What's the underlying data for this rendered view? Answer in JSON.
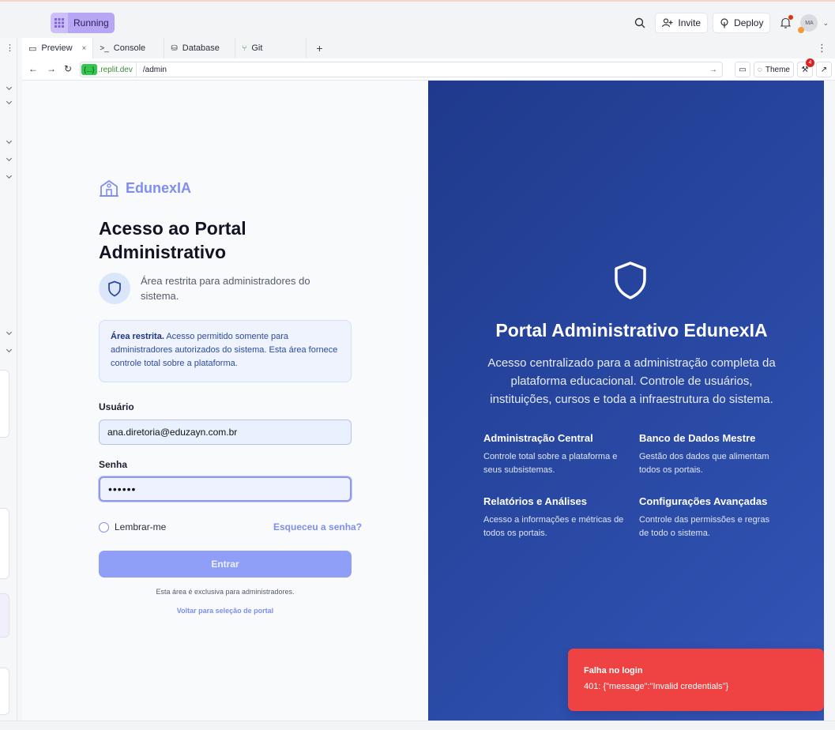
{
  "topbar": {
    "status_label": "Running",
    "invite_label": "Invite",
    "deploy_label": "Deploy",
    "avatar_initials": "MA"
  },
  "tabs": [
    {
      "label": "Preview",
      "active": true
    },
    {
      "label": "Console",
      "active": false
    },
    {
      "label": "Database",
      "active": false
    },
    {
      "label": "Git",
      "active": false
    }
  ],
  "urlbar": {
    "domain_chip": "{...}",
    "domain": ".replit.dev",
    "path": "/admin",
    "theme_label": "Theme",
    "notification_count": "4"
  },
  "login": {
    "brand": "EdunexIA",
    "title": "Acesso ao Portal Administrativo",
    "subtitle": "Área restrita para administradores do sistema.",
    "alert_bold": "Área restrita.",
    "alert_text": " Acesso permitido somente para administradores autorizados do sistema. Esta área fornece controle total sobre a plataforma.",
    "user_label": "Usuário",
    "user_value": "ana.diretoria@eduzayn.com.br",
    "password_label": "Senha",
    "password_value": "••••••",
    "remember_label": "Lembrar-me",
    "forgot_label": "Esqueceu a senha?",
    "submit_label": "Entrar",
    "exclusive_note": "Esta área é exclusiva para administradores.",
    "back_link": "Voltar para seleção de portal"
  },
  "hero": {
    "title": "Portal Administrativo EdunexIA",
    "description": "Acesso centralizado para a administração completa da plataforma educacional. Controle de usuários, instituições, cursos e toda a infraestrutura do sistema.",
    "features": [
      {
        "title": "Administração Central",
        "desc": "Controle total sobre a plataforma e seus subsistemas."
      },
      {
        "title": "Banco de Dados Mestre",
        "desc": "Gestão dos dados que alimentam todos os portais."
      },
      {
        "title": "Relatórios e Análises",
        "desc": "Acesso a informações e métricas de todos os portais."
      },
      {
        "title": "Configurações Avançadas",
        "desc": "Controle das permissões e regras de todo o sistema."
      }
    ]
  },
  "toast": {
    "title": "Falha no login",
    "message": "401: {\"message\":\"Invalid credentials\"}"
  },
  "colors": {
    "accent": "#7f8ef0",
    "hero_bg": "#233f94",
    "toast_bg": "#ef4343"
  }
}
